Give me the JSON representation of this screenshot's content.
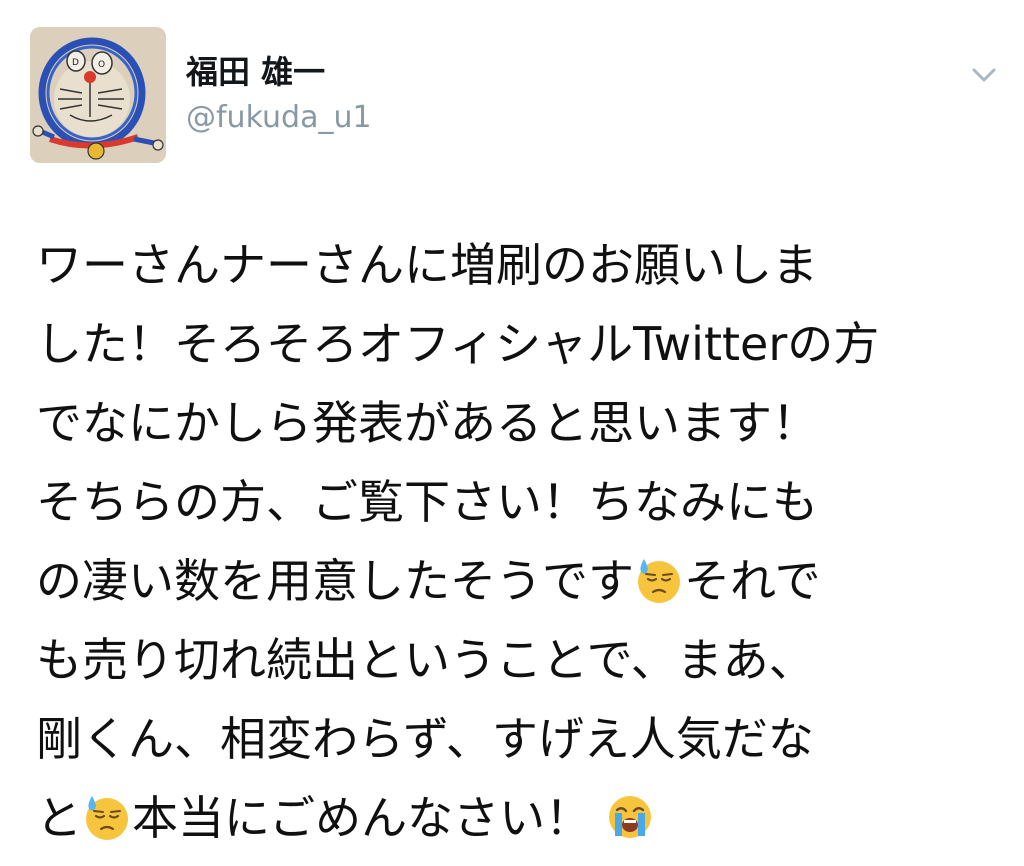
{
  "user": {
    "display_name": "福田 雄一",
    "screen_name": "@fukuda_u1",
    "avatar_icon": "doraemon-drawing-avatar"
  },
  "menu": {
    "icon": "chevron-down-icon"
  },
  "tweet": {
    "lines": [
      "ワーさんナーさんに増刷のお願いしま",
      "した！そろそろオフィシャルTwitterの方",
      "でなにかしら発表があると思います！",
      "そちらの方、ご覧下さい！ちなみにも",
      "の凄い数を用意したそうです",
      "それで",
      "も売り切れ続出ということで、まあ、",
      "剛くん、相変わらず、すげえ人気だな",
      "と",
      "本当にごめんなさい！"
    ],
    "emoji": {
      "sweat": "downcast-face-with-sweat-emoji",
      "cry": "loudly-crying-face-emoji"
    }
  },
  "colors": {
    "text": "#101010",
    "secondary": "#8899a6",
    "emoji_yellow": "#f7c53d",
    "sweat_blue": "#58b5f0",
    "tear_blue": "#4aa8e8"
  }
}
